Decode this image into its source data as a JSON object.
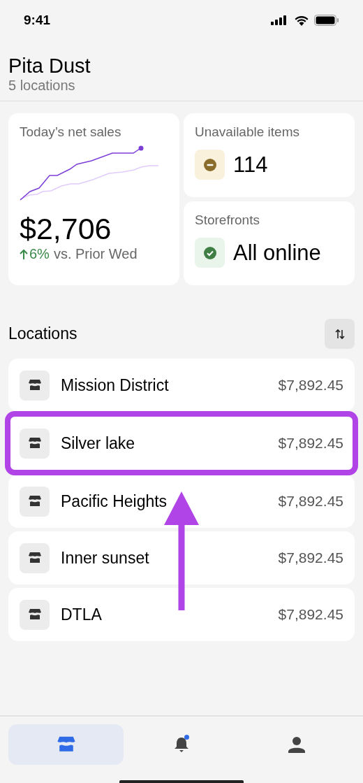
{
  "status_bar": {
    "time": "9:41"
  },
  "header": {
    "title": "Pita Dust",
    "subtitle": "5 locations"
  },
  "sales_card": {
    "title": "Today’s net sales",
    "amount": "$2,706",
    "change": "6%",
    "comparison": "vs. Prior Wed"
  },
  "unavailable_card": {
    "title": "Unavailable items",
    "value": "114"
  },
  "storefronts_card": {
    "title": "Storefronts",
    "value": "All online"
  },
  "locations": {
    "title": "Locations",
    "rows": [
      {
        "name": "Mission District",
        "amount": "$7,892.45",
        "highlighted": false
      },
      {
        "name": "Silver lake",
        "amount": "$7,892.45",
        "highlighted": true
      },
      {
        "name": "Pacific Heights",
        "amount": "$7,892.45",
        "highlighted": false
      },
      {
        "name": "Inner sunset",
        "amount": "$7,892.45",
        "highlighted": false
      },
      {
        "name": "DTLA",
        "amount": "$7,892.45",
        "highlighted": false
      }
    ]
  },
  "tab_bar": [
    {
      "kind": "store",
      "selected": true,
      "badge": false
    },
    {
      "kind": "bell",
      "selected": false,
      "badge": true
    },
    {
      "kind": "person",
      "selected": false,
      "badge": false
    }
  ]
}
